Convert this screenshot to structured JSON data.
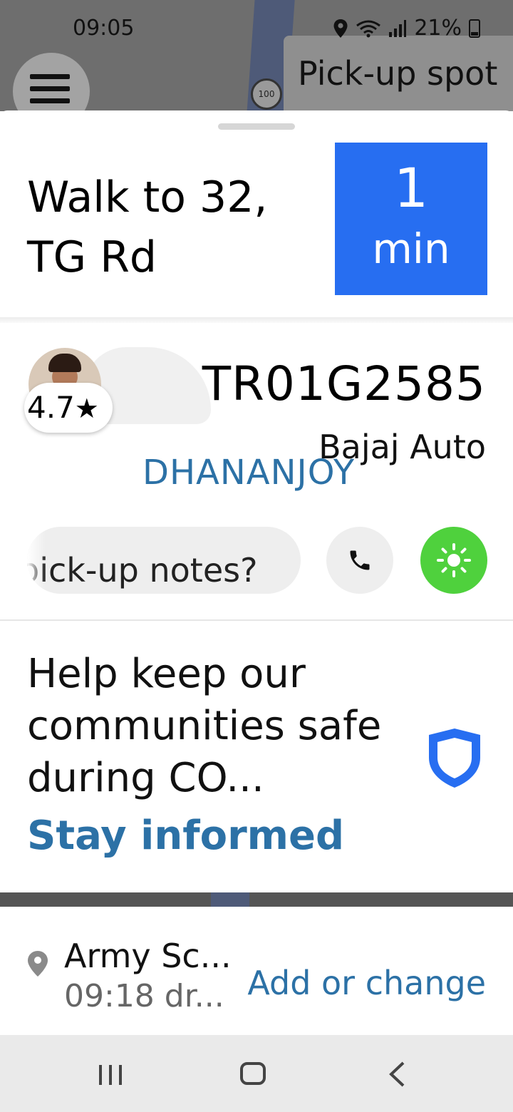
{
  "status_bar": {
    "time": "09:05",
    "battery": "21%"
  },
  "map": {
    "pickup_chip": "Pick-up spot",
    "speed_sign": "100"
  },
  "trip": {
    "walk_title": "Walk to 32, TG Rd",
    "eta_value": "1",
    "eta_unit": "min"
  },
  "driver": {
    "rating": "4.7",
    "plate": "TR01G2585",
    "vehicle": "Bajaj Auto",
    "name": "DHANANJOY"
  },
  "actions": {
    "notes_label": "pick-up notes?",
    "call_icon": "phone-icon",
    "light_icon": "sun-icon"
  },
  "safety": {
    "message": "Help keep our communities safe during CO...",
    "link": "Stay informed",
    "icon": "shield-icon"
  },
  "destination": {
    "name": "Army Sc...",
    "time": "09:18 dr...",
    "action": "Add or change"
  },
  "colors": {
    "accent_blue": "#276ef1",
    "link_blue": "#2c71a6",
    "green": "#4fd13d"
  }
}
